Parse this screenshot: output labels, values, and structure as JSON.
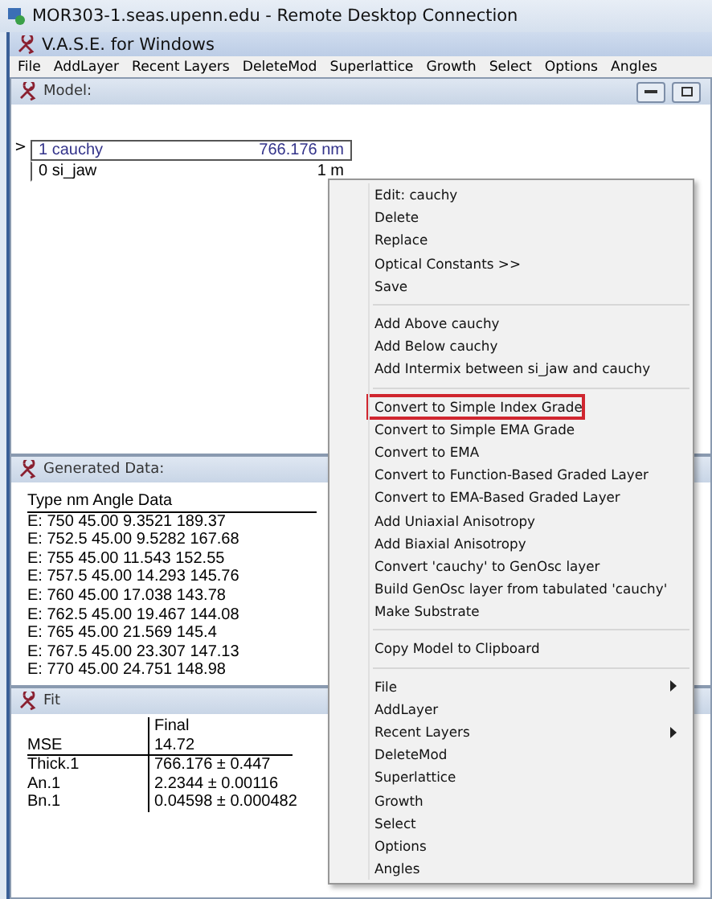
{
  "window": {
    "title": "MOR303-1.seas.upenn.edu - Remote Desktop Connection"
  },
  "app": {
    "title": "V.A.S.E. for Windows"
  },
  "menu_bar": [
    "File",
    "AddLayer",
    "Recent Layers",
    "DeleteMod",
    "Superlattice",
    "Growth",
    "Select",
    "Options",
    "Angles"
  ],
  "model": {
    "title": "Model:",
    "layers": [
      {
        "marker": ">",
        "name": "1 cauchy",
        "thickness": "766.176 nm",
        "selected": true
      },
      {
        "name": "0 si_jaw",
        "thickness": "1 m",
        "selected": false
      }
    ]
  },
  "generated_data": {
    "title": "Generated Data:",
    "header": "Type  nm  Angle  Data",
    "rows": [
      "E: 750  45.00  9.3521  189.37",
      "E: 752.5  45.00  9.5282  167.68",
      "E: 755  45.00  11.543  152.55",
      "E: 757.5  45.00  14.293  145.76",
      "E: 760  45.00  17.038  143.78",
      "E: 762.5  45.00  19.467  144.08",
      "E: 765  45.00  21.569  145.4",
      "E: 767.5  45.00  23.307  147.13",
      "E: 770  45.00  24.751  148.98"
    ]
  },
  "fit": {
    "title": "Fit",
    "column": "Final",
    "rows": [
      {
        "name": "MSE",
        "value": "14.72"
      },
      {
        "name": "Thick.1",
        "value": "766.176 ± 0.447"
      },
      {
        "name": "An.1",
        "value": "2.2344 ± 0.00116"
      },
      {
        "name": "Bn.1",
        "value": "0.04598 ± 0.000482"
      }
    ]
  },
  "context_menu": [
    {
      "kind": "item",
      "label": "Edit: cauchy",
      "highlighted": false,
      "submenu": false
    },
    {
      "kind": "item",
      "label": "Delete",
      "highlighted": false,
      "submenu": false
    },
    {
      "kind": "item",
      "label": "Replace",
      "highlighted": false,
      "submenu": false
    },
    {
      "kind": "item",
      "label": "Optical Constants >>",
      "highlighted": false,
      "submenu": false
    },
    {
      "kind": "item",
      "label": "Save",
      "highlighted": false,
      "submenu": false
    },
    {
      "kind": "separator"
    },
    {
      "kind": "item",
      "label": "Add Above cauchy",
      "highlighted": false,
      "submenu": false
    },
    {
      "kind": "item",
      "label": "Add Below cauchy",
      "highlighted": false,
      "submenu": false
    },
    {
      "kind": "item",
      "label": "Add Intermix between si_jaw and cauchy",
      "highlighted": false,
      "submenu": false
    },
    {
      "kind": "separator"
    },
    {
      "kind": "item",
      "label": "Convert to Simple Index Grade",
      "highlighted": true,
      "submenu": false
    },
    {
      "kind": "item",
      "label": "Convert to Simple EMA Grade",
      "highlighted": false,
      "submenu": false
    },
    {
      "kind": "item",
      "label": "Convert to EMA",
      "highlighted": false,
      "submenu": false
    },
    {
      "kind": "item",
      "label": "Convert to Function-Based Graded Layer",
      "highlighted": false,
      "submenu": false
    },
    {
      "kind": "item",
      "label": "Convert to EMA-Based Graded Layer",
      "highlighted": false,
      "submenu": false
    },
    {
      "kind": "item",
      "label": "Add Uniaxial Anisotropy",
      "highlighted": false,
      "submenu": false
    },
    {
      "kind": "item",
      "label": "Add Biaxial Anisotropy",
      "highlighted": false,
      "submenu": false
    },
    {
      "kind": "item",
      "label": "Convert 'cauchy' to GenOsc layer",
      "highlighted": false,
      "submenu": false
    },
    {
      "kind": "item",
      "label": "Build GenOsc layer from tabulated 'cauchy'",
      "highlighted": false,
      "submenu": false
    },
    {
      "kind": "item",
      "label": "Make Substrate",
      "highlighted": false,
      "submenu": false
    },
    {
      "kind": "separator"
    },
    {
      "kind": "item",
      "label": "Copy Model to Clipboard",
      "highlighted": false,
      "submenu": false
    },
    {
      "kind": "separator"
    },
    {
      "kind": "item",
      "label": "File",
      "highlighted": false,
      "submenu": true
    },
    {
      "kind": "item",
      "label": "AddLayer",
      "highlighted": false,
      "submenu": false
    },
    {
      "kind": "item",
      "label": "Recent Layers",
      "highlighted": false,
      "submenu": true
    },
    {
      "kind": "item",
      "label": "DeleteMod",
      "highlighted": false,
      "submenu": false
    },
    {
      "kind": "item",
      "label": "Superlattice",
      "highlighted": false,
      "submenu": false
    },
    {
      "kind": "item",
      "label": "Growth",
      "highlighted": false,
      "submenu": false
    },
    {
      "kind": "item",
      "label": "Select",
      "highlighted": false,
      "submenu": false
    },
    {
      "kind": "item",
      "label": "Options",
      "highlighted": false,
      "submenu": false
    },
    {
      "kind": "item",
      "label": "Angles",
      "highlighted": false,
      "submenu": false
    }
  ]
}
